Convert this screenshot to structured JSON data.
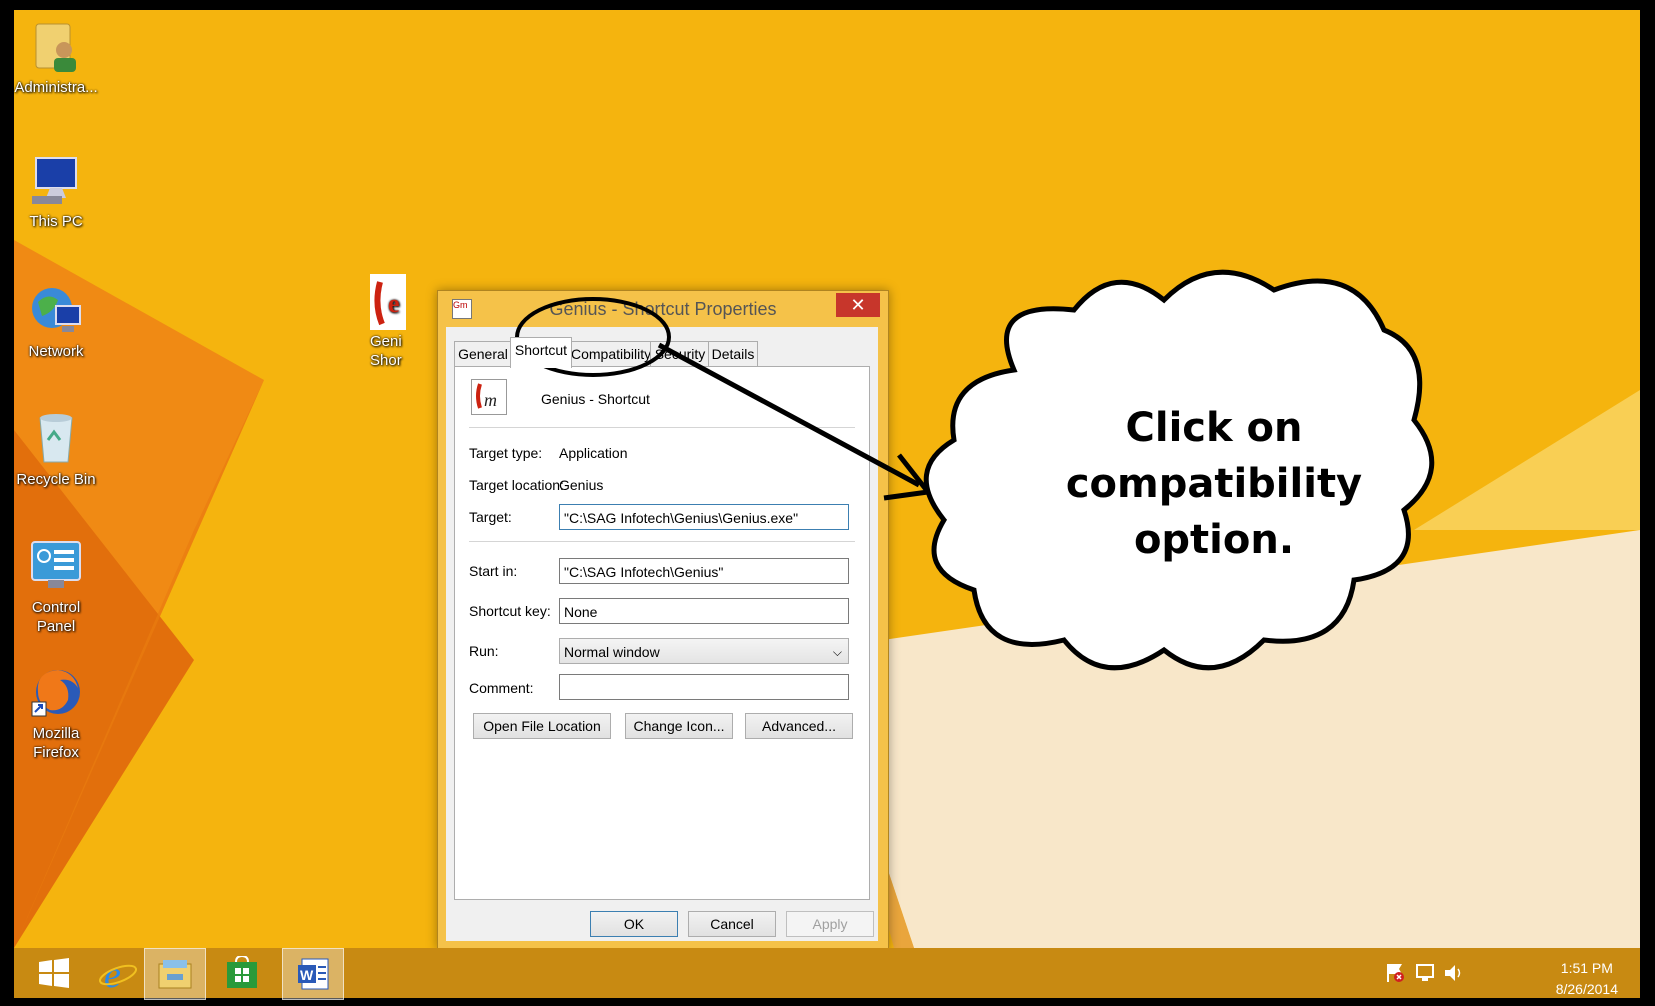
{
  "desktop": {
    "icons": [
      {
        "label": "Administra...",
        "icon": "user-folder-icon"
      },
      {
        "label": "This PC",
        "icon": "computer-icon"
      },
      {
        "label": "Network",
        "icon": "network-globe-icon"
      },
      {
        "label": "Recycle Bin",
        "icon": "recycle-bin-icon"
      },
      {
        "label": "Control\nPanel",
        "icon": "control-panel-icon"
      },
      {
        "label": "Mozilla\nFirefox",
        "icon": "firefox-icon"
      }
    ],
    "partial_icon": {
      "line1": "Geni",
      "line2": "Shor"
    }
  },
  "dialog": {
    "title": "Genius - Shortcut Properties",
    "close": "✕",
    "tabs": [
      "General",
      "Shortcut",
      "Compatibility",
      "Security",
      "Details"
    ],
    "selected_tab": "Shortcut",
    "shortcut_name": "Genius - Shortcut",
    "target_type_label": "Target type:",
    "target_type_value": "Application",
    "target_location_label": "Target location:",
    "target_location_value": "Genius",
    "target_label": "Target:",
    "target_value": "\"C:\\SAG Infotech\\Genius\\Genius.exe\"",
    "start_in_label": "Start in:",
    "start_in_value": "\"C:\\SAG Infotech\\Genius\"",
    "shortcut_key_label": "Shortcut key:",
    "shortcut_key_value": "None",
    "run_label": "Run:",
    "run_value": "Normal window",
    "comment_label": "Comment:",
    "comment_value": "",
    "open_file_location": "Open File Location",
    "change_icon": "Change Icon...",
    "advanced": "Advanced...",
    "ok": "OK",
    "cancel": "Cancel",
    "apply": "Apply"
  },
  "callout": {
    "text_line1": "Click on",
    "text_line2": "compatibility",
    "text_line3": "option."
  },
  "taskbar": {
    "time": "1:51 PM",
    "date": "8/26/2014"
  },
  "colors": {
    "wallpaper": "#f5b40e",
    "taskbar": "#c88a12",
    "dialog_frame": "#f5c249",
    "close_button": "#c7362b"
  }
}
